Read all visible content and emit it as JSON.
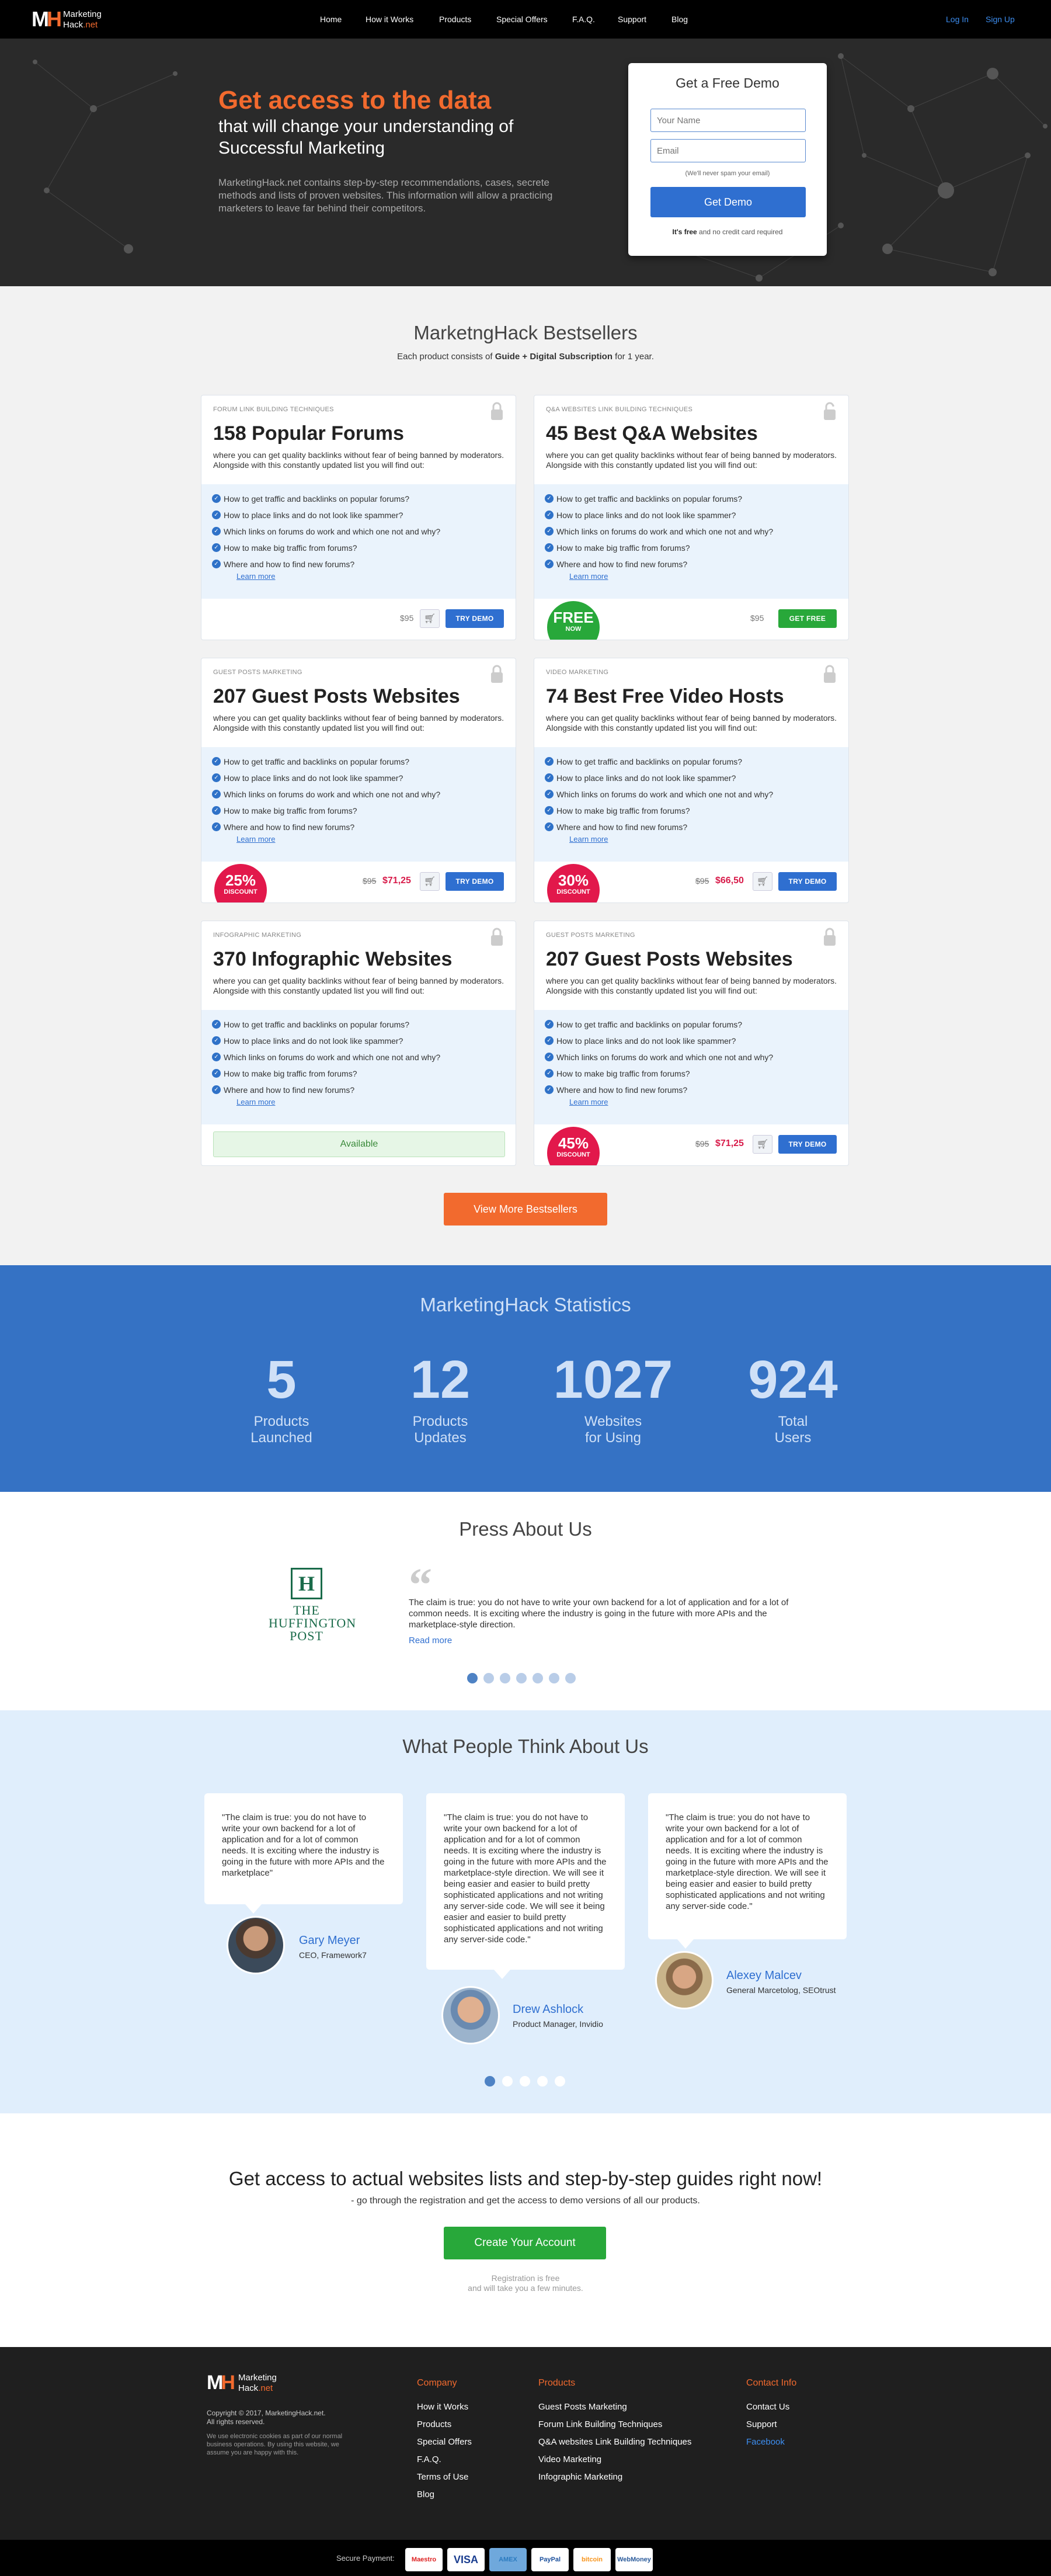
{
  "header": {
    "logo_mark_m": "M",
    "logo_mark_h": "H",
    "logo_line1": "Marketing",
    "logo_line2": "Hack",
    "logo_tld": ".net",
    "nav": [
      "Home",
      "How it Works",
      "Products",
      "Special Offers",
      "F.A.Q.",
      "Support",
      "Blog"
    ],
    "login": "Log In",
    "signup": "Sign Up"
  },
  "hero": {
    "title": "Get access to the data",
    "subtitle": "that will change your understanding of Successful Marketing",
    "description": "MarketingHack.net contains step-by-step recommendations, cases, secrete methods and lists of proven websites. This information will allow a practicing marketers to leave far behind their competitors.",
    "demo_title": "Get a Free Demo",
    "name_placeholder": "Your Name",
    "email_placeholder": "Email",
    "spam_note": "(We'll never spam your email)",
    "demo_button": "Get Demo",
    "free_bold": "It's free",
    "free_rest": " and no credit card required"
  },
  "bestsellers": {
    "title": "MarketngHack Bestsellers",
    "sub_pre": "Each product consists of ",
    "sub_bold": "Guide + Digital Subscription",
    "sub_post": " for 1 year.",
    "learn_more": "Learn more",
    "description": "where you can get quality backlinks without fear of being banned by moderators. Alongside with this constantly updated list you will find out:",
    "features": [
      "How to get traffic and backlinks on popular forums?",
      "How to place links and do not look like spammer?",
      "Which links on forums do work and which one not and why?",
      "How to make big traffic from forums?",
      "Where and how to find new forums?"
    ],
    "cards": [
      {
        "category": "Forum Link Building Techniques",
        "title": "158 Popular Forums",
        "old_price": "$95",
        "new_price": "",
        "button": "TRY DEMO",
        "badge_big": "",
        "badge_small": ""
      },
      {
        "category": "Q&A Websites Link Building Techniques",
        "title": "45 Best Q&A Websites",
        "old_price": "$95",
        "new_price": "",
        "button": "GET FREE",
        "badge_big": "FREE",
        "badge_small": "NOW"
      },
      {
        "category": "Guest Posts Marketing",
        "title": "207 Guest Posts Websites",
        "old_price": "$95",
        "new_price": "$71,25",
        "button": "TRY DEMO",
        "badge_big": "25%",
        "badge_small": "DISCOUNT"
      },
      {
        "category": "Video Marketing",
        "title": "74 Best Free Video Hosts",
        "old_price": "$95",
        "new_price": "$66,50",
        "button": "TRY DEMO",
        "badge_big": "30%",
        "badge_small": "DISCOUNT"
      },
      {
        "category": "Infographic Marketing",
        "title": "370 Infographic Websites",
        "available": "Available"
      },
      {
        "category": "Guest Posts Marketing",
        "title": "207 Guest Posts Websites",
        "old_price": "$95",
        "new_price": "$71,25",
        "button": "TRY DEMO",
        "badge_big": "45%",
        "badge_small": "DISCOUNT"
      }
    ],
    "more_button": "View More Bestsellers"
  },
  "stats": {
    "title": "MarketingHack Statistics",
    "items": [
      {
        "value": "5",
        "line1": "Products",
        "line2": "Launched"
      },
      {
        "value": "12",
        "line1": "Products",
        "line2": "Updates"
      },
      {
        "value": "1027",
        "line1": "Websites",
        "line2": "for Using"
      },
      {
        "value": "924",
        "line1": "Total",
        "line2": "Users"
      }
    ]
  },
  "press": {
    "title": "Press About Us",
    "logo_letter": "H",
    "logo_line1": "THE",
    "logo_line2": "HUFFINGTON",
    "logo_line3": "POST",
    "text": "The claim is true: you do not have to write your own backend for a lot of application and for a lot of common needs. It is exciting where the industry is going in the future with more APIs and the marketplace-style direction.",
    "read_more": "Read more",
    "dot_count": 7,
    "active_dot": 0
  },
  "testimonials": {
    "title": "What People Think About Us",
    "items": [
      {
        "quote": "\"The claim is true: you do not have to write your own backend for a lot of application and for a lot of common needs. It is exciting where the industry is going in the future with more APIs and the marketplace\"",
        "name": "Gary Meyer",
        "role": "CEO, Framework7"
      },
      {
        "quote": "\"The claim is true: you do not have to write your own backend for a lot of application and for a lot of common needs. It is exciting where the industry is going in the future with more APIs and the marketplace-style direction. We will see it being easier and easier to build pretty sophisticated applications and not writing any server-side code. We will see it being easier and easier to build pretty sophisticated applications and not writing any server-side code.\"",
        "name": "Drew Ashlock",
        "role": "Product Manager, Invidio"
      },
      {
        "quote": "\"The claim is true: you do not have to write your own backend for a lot of application and for a lot of common needs. It is exciting where the industry is going in the future with more APIs and the marketplace-style direction. We will see it being easier and easier to build pretty sophisticated applications and not writing any server-side code.\"",
        "name": "Alexey Malcev",
        "role": "General Marcetolog, SEOtrust"
      }
    ],
    "dot_count": 5,
    "active_dot": 0
  },
  "cta": {
    "title": "Get access to actual websites lists and step-by-step guides right now!",
    "subtitle": "- go through the registration and get the access to demo versions of all our products.",
    "button": "Create Your Account",
    "note1": "Registration is free",
    "note2": "and will take you a few minutes."
  },
  "footer": {
    "copyright": "Copyright © 2017, MarketingHack.net.",
    "rights": "All rights reserved.",
    "cookie": "We use electronic cookies as part of our normal business operations. By using this website, we assume you are happy with this.",
    "company_head": "Company",
    "company_links": [
      "How it Works",
      "Products",
      "Special Offers",
      "F.A.Q.",
      "Terms of Use",
      "Blog"
    ],
    "products_head": "Products",
    "products_links": [
      "Guest Posts Marketing",
      "Forum Link Building Techniques",
      "Q&A websites Link Building Techniques",
      "Video Marketing",
      "Infographic Marketing"
    ],
    "contact_head": "Contact Info",
    "contact_links": [
      "Contact Us",
      "Support",
      "Facebook"
    ],
    "secure_label": "Secure Payment:",
    "payments": [
      "Maestro",
      "VISA",
      "AMEX",
      "PayPal",
      "bitcoin",
      "WebMoney"
    ]
  },
  "colors": {
    "orange": "#f26a2e",
    "blue": "#2f6fd0",
    "green": "#28a83a",
    "red": "#e2184b",
    "stats_bg": "#3572c4"
  },
  "icons": [
    "lock-icon",
    "check-icon",
    "cart-icon",
    "quote-icon"
  ]
}
